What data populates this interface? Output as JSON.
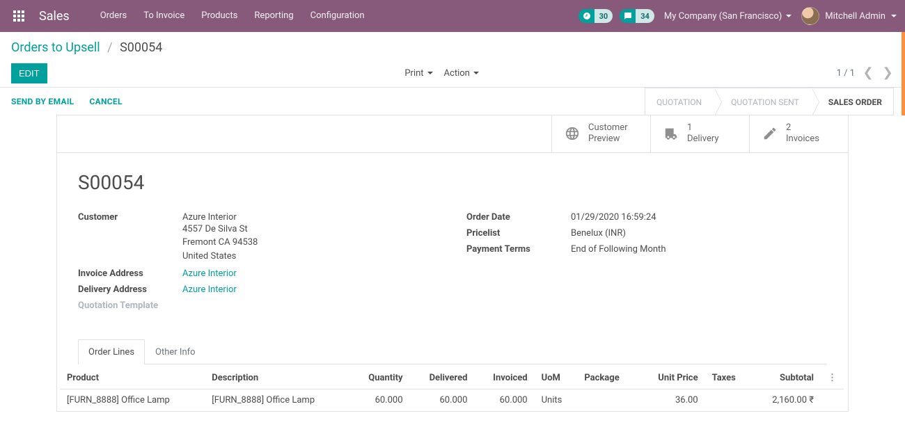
{
  "navbar": {
    "brand": "Sales",
    "menu": [
      "Orders",
      "To Invoice",
      "Products",
      "Reporting",
      "Configuration"
    ],
    "timer_badge": "30",
    "discuss_badge": "34",
    "company": "My Company (San Francisco)",
    "user": "Mitchell Admin"
  },
  "breadcrumb": {
    "parent": "Orders to Upsell",
    "current": "S00054"
  },
  "buttons": {
    "edit": "EDIT",
    "print": "Print",
    "action": "Action"
  },
  "pager": {
    "pos": "1 / 1"
  },
  "statusbar": {
    "send": "SEND BY EMAIL",
    "cancel": "CANCEL",
    "steps": [
      "QUOTATION",
      "QUOTATION SENT",
      "SALES ORDER"
    ]
  },
  "statbtns": {
    "preview": "Customer\nPreview",
    "delivery_n": "1",
    "delivery_l": "Delivery",
    "invoices_n": "2",
    "invoices_l": "Invoices"
  },
  "order": {
    "name": "S00054",
    "labels": {
      "customer": "Customer",
      "invoice_addr": "Invoice Address",
      "delivery_addr": "Delivery Address",
      "quot_tmpl": "Quotation Template",
      "order_date": "Order Date",
      "pricelist": "Pricelist",
      "payment_terms": "Payment Terms"
    },
    "customer": {
      "name": "Azure Interior",
      "street": "4557 De Silva St",
      "city": "Fremont CA 94538",
      "country": "United States"
    },
    "invoice_addr": "Azure Interior",
    "delivery_addr": "Azure Interior",
    "order_date": "01/29/2020 16:59:24",
    "pricelist": "Benelux (INR)",
    "payment_terms": "End of Following Month"
  },
  "tabs": {
    "lines": "Order Lines",
    "other": "Other Info"
  },
  "table": {
    "headers": {
      "product": "Product",
      "desc": "Description",
      "qty": "Quantity",
      "delivered": "Delivered",
      "invoiced": "Invoiced",
      "uom": "UoM",
      "package": "Package",
      "unit_price": "Unit Price",
      "taxes": "Taxes",
      "subtotal": "Subtotal"
    },
    "rows": [
      {
        "product": "[FURN_8888] Office Lamp",
        "desc": "[FURN_8888] Office Lamp",
        "qty": "60.000",
        "delivered": "60.000",
        "invoiced": "60.000",
        "uom": "Units",
        "package": "",
        "unit_price": "36.00",
        "taxes": "",
        "subtotal": "2,160.00 ₹"
      }
    ]
  }
}
